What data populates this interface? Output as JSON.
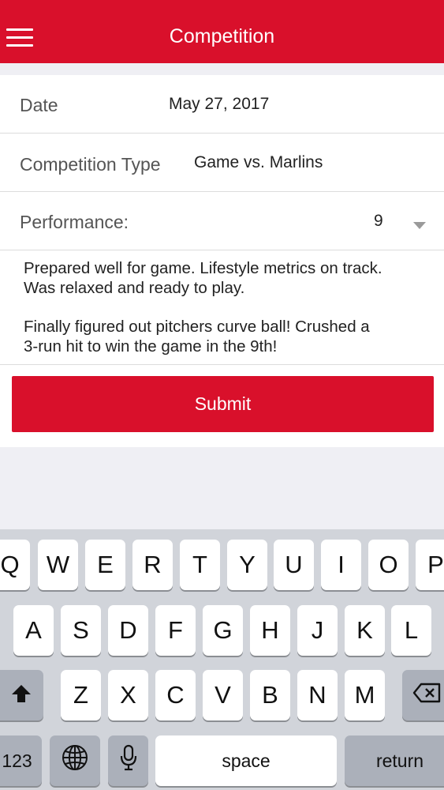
{
  "navbar": {
    "title": "Competition",
    "menu_icon": "hamburger-menu-icon"
  },
  "form": {
    "date": {
      "label": "Date",
      "value": "May 27, 2017"
    },
    "competition_type": {
      "label": "Competition Type",
      "value": "Game vs. Marlins"
    },
    "performance": {
      "label": "Performance:",
      "value": "9",
      "icon": "chevron-down-icon"
    },
    "notes": {
      "paragraph1": "Prepared well for game. Lifestyle metrics on track.\nWas relaxed and ready to play.",
      "paragraph2": "Finally figured out pitchers curve ball! Crushed a\n3-run hit to win the game in the 9th!"
    },
    "submit_label": "Submit"
  },
  "colors": {
    "accent": "#d9102b",
    "keyboard_bg": "#d1d4da",
    "special_key": "#abb0ba"
  },
  "keyboard": {
    "row1": [
      "Q",
      "W",
      "E",
      "R",
      "T",
      "Y",
      "U",
      "I",
      "O",
      "P"
    ],
    "row2": [
      "A",
      "S",
      "D",
      "F",
      "G",
      "H",
      "J",
      "K",
      "L"
    ],
    "row3": [
      "Z",
      "X",
      "C",
      "V",
      "B",
      "N",
      "M"
    ],
    "numbers_label": "123",
    "space_label": "space",
    "return_label": "return",
    "icons": [
      "shift-icon",
      "backspace-icon",
      "globe-icon",
      "microphone-icon"
    ]
  }
}
